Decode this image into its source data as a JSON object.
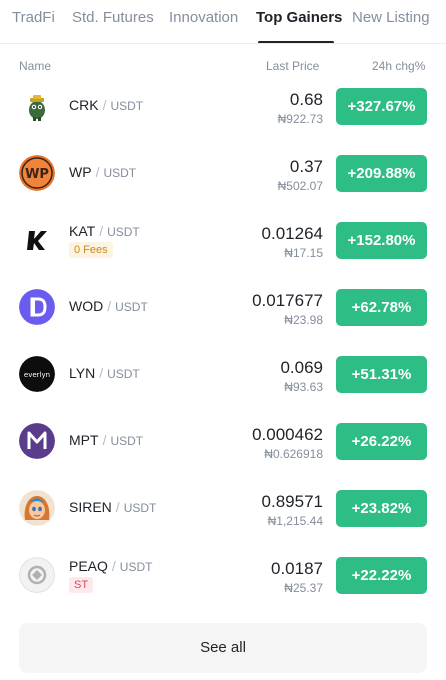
{
  "tabs": [
    {
      "label": "TradFi"
    },
    {
      "label": "Std. Futures"
    },
    {
      "label": "Innovation"
    },
    {
      "label": "Top Gainers"
    },
    {
      "label": "New Listing"
    }
  ],
  "active_tab": "Top Gainers",
  "columns": {
    "name": "Name",
    "price": "Last Price",
    "change": "24h chg%"
  },
  "rows": [
    {
      "symbol": "CRK",
      "quote": "USDT",
      "price": "0.68",
      "local": "₦922.73",
      "change": "+327.67%",
      "logo": "crk-logo-icon"
    },
    {
      "symbol": "WP",
      "quote": "USDT",
      "price": "0.37",
      "local": "₦502.07",
      "change": "+209.88%",
      "logo": "wp-logo-icon",
      "logo_text": "WP"
    },
    {
      "symbol": "KAT",
      "quote": "USDT",
      "tag": "0 Fees",
      "price": "0.01264",
      "local": "₦17.15",
      "change": "+152.80%",
      "logo": "kat-logo-icon"
    },
    {
      "symbol": "WOD",
      "quote": "USDT",
      "price": "0.017677",
      "local": "₦23.98",
      "change": "+62.78%",
      "logo": "wod-logo-icon"
    },
    {
      "symbol": "LYN",
      "quote": "USDT",
      "price": "0.069",
      "local": "₦93.63",
      "change": "+51.31%",
      "logo": "lyn-logo-icon",
      "logo_text": "everlyn"
    },
    {
      "symbol": "MPT",
      "quote": "USDT",
      "price": "0.000462",
      "local": "₦0.626918",
      "change": "+26.22%",
      "logo": "mpt-logo-icon"
    },
    {
      "symbol": "SIREN",
      "quote": "USDT",
      "price": "0.89571",
      "local": "₦1,215.44",
      "change": "+23.82%",
      "logo": "siren-logo-icon"
    },
    {
      "symbol": "PEAQ",
      "quote": "USDT",
      "tag": "ST",
      "price": "0.0187",
      "local": "₦25.37",
      "change": "+22.22%",
      "logo": "peaq-logo-icon"
    }
  ],
  "see_all": "See all",
  "colors": {
    "gain": "#2ebd85",
    "text": "#1e2329",
    "muted": "#848e9c",
    "fees_tag": "#c98a1d",
    "st_tag": "#e0465d"
  }
}
